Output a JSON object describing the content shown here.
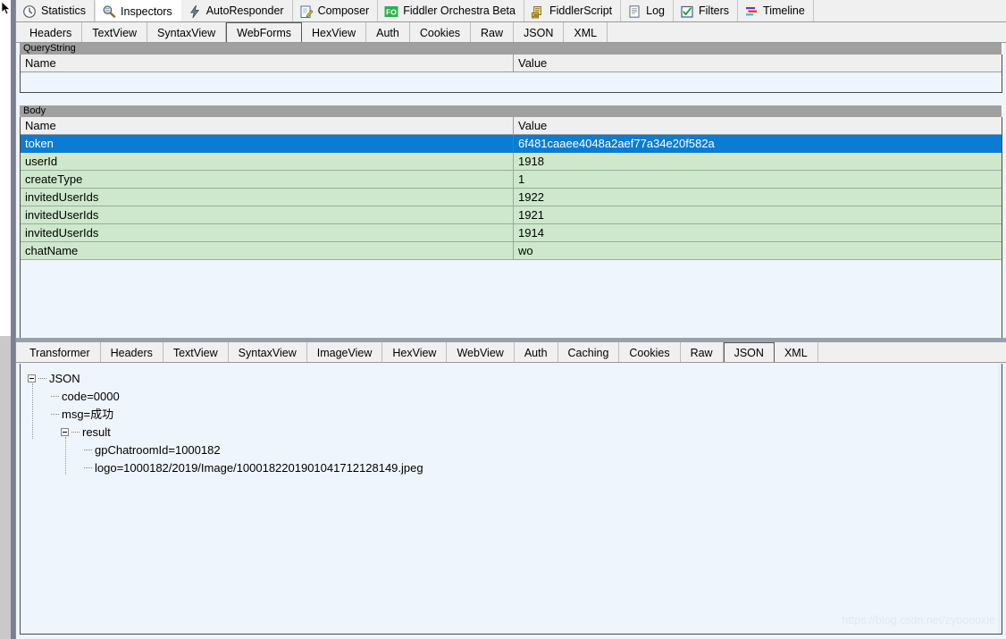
{
  "app": {
    "watermark": "https://blog.csdn.net/zyooooxie"
  },
  "top_tabs": [
    {
      "label": "Statistics",
      "icon": "clock-icon",
      "active": false
    },
    {
      "label": "Inspectors",
      "icon": "magnifier-icon",
      "active": true
    },
    {
      "label": "AutoResponder",
      "icon": "lightning-icon",
      "active": false
    },
    {
      "label": "Composer",
      "icon": "compose-icon",
      "active": false
    },
    {
      "label": "Fiddler Orchestra Beta",
      "icon": "fo-badge-icon",
      "active": false
    },
    {
      "label": "FiddlerScript",
      "icon": "script-js-icon",
      "active": false
    },
    {
      "label": "Log",
      "icon": "log-icon",
      "active": false
    },
    {
      "label": "Filters",
      "icon": "checkbox-icon",
      "active": false
    },
    {
      "label": "Timeline",
      "icon": "timeline-icon",
      "active": false
    }
  ],
  "request_tabs": [
    {
      "label": "Headers",
      "active": false
    },
    {
      "label": "TextView",
      "active": false
    },
    {
      "label": "SyntaxView",
      "active": false
    },
    {
      "label": "WebForms",
      "active": true
    },
    {
      "label": "HexView",
      "active": false
    },
    {
      "label": "Auth",
      "active": false
    },
    {
      "label": "Cookies",
      "active": false
    },
    {
      "label": "Raw",
      "active": false
    },
    {
      "label": "JSON",
      "active": false
    },
    {
      "label": "XML",
      "active": false
    }
  ],
  "querystring": {
    "group_label": "QueryString",
    "columns": {
      "name": "Name",
      "value": "Value"
    },
    "rows": []
  },
  "body": {
    "group_label": "Body",
    "columns": {
      "name": "Name",
      "value": "Value"
    },
    "rows": [
      {
        "name": "token",
        "value": "6f481caaee4048a2aef77a34e20f582a",
        "selected": true
      },
      {
        "name": "userId",
        "value": "1918",
        "selected": false
      },
      {
        "name": "createType",
        "value": "1",
        "selected": false
      },
      {
        "name": "invitedUserIds",
        "value": "1922",
        "selected": false
      },
      {
        "name": "invitedUserIds",
        "value": "1921",
        "selected": false
      },
      {
        "name": "invitedUserIds",
        "value": "1914",
        "selected": false
      },
      {
        "name": "chatName",
        "value": "wo",
        "selected": false
      }
    ]
  },
  "response_tabs": [
    {
      "label": "Transformer",
      "active": false
    },
    {
      "label": "Headers",
      "active": false
    },
    {
      "label": "TextView",
      "active": false
    },
    {
      "label": "SyntaxView",
      "active": false
    },
    {
      "label": "ImageView",
      "active": false
    },
    {
      "label": "HexView",
      "active": false
    },
    {
      "label": "WebView",
      "active": false
    },
    {
      "label": "Auth",
      "active": false
    },
    {
      "label": "Caching",
      "active": false
    },
    {
      "label": "Cookies",
      "active": false
    },
    {
      "label": "Raw",
      "active": false
    },
    {
      "label": "JSON",
      "active": true
    },
    {
      "label": "XML",
      "active": false
    }
  ],
  "json_tree": [
    {
      "label": "JSON",
      "depth": 0,
      "expander": true
    },
    {
      "label": "code=0000",
      "depth": 1,
      "expander": false
    },
    {
      "label": "msg=成功",
      "depth": 1,
      "expander": false
    },
    {
      "label": "result",
      "depth": 1,
      "expander": true
    },
    {
      "label": "gpChatroomId=1000182",
      "depth": 2,
      "expander": false
    },
    {
      "label": "logo=1000182/2019/Image/1000182201901041712128149.jpeg",
      "depth": 2,
      "expander": false
    }
  ],
  "colors": {
    "selected_row": "#0a7cd4",
    "data_row": "#cde8cd",
    "panel_bg": "#eff5fc",
    "group_header": "#a0a0a0",
    "orchestra_badge": "#2ab34a"
  }
}
